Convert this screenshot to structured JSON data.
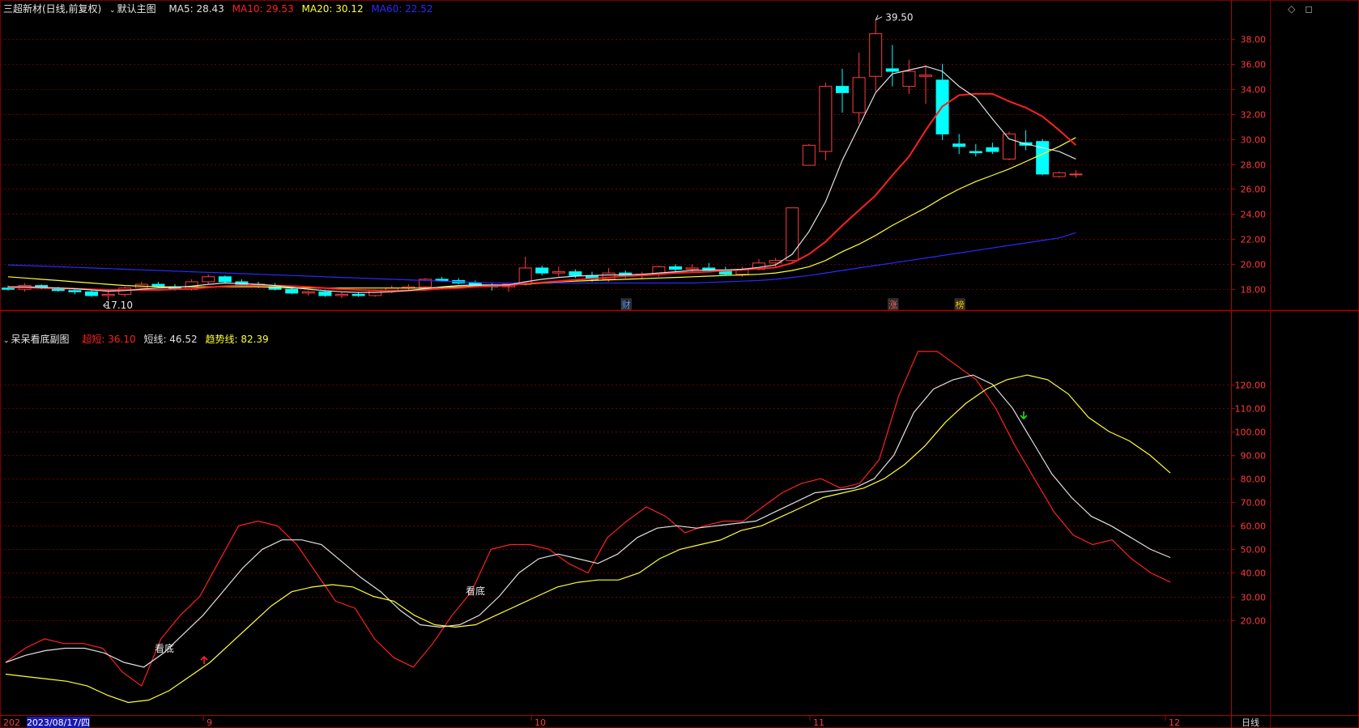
{
  "main_header": {
    "stock": "三超新材(日线,前复权)",
    "view": "默认主图",
    "ma": [
      {
        "label": "MA5: 28.43",
        "color": "#e0e0e0"
      },
      {
        "label": "MA10: 29.53",
        "color": "#ff2020"
      },
      {
        "label": "MA20: 30.12",
        "color": "#ffff33"
      },
      {
        "label": "MA60: 22.52",
        "color": "#2a2aff"
      }
    ]
  },
  "sub_header": {
    "title": "呆呆看底副图",
    "lines": [
      {
        "label": "超短: 36.10",
        "color": "#ff2020"
      },
      {
        "label": "短线: 46.52",
        "color": "#e0e0e0"
      },
      {
        "label": "趋势线: 82.39",
        "color": "#ffff33"
      }
    ]
  },
  "window_icons": {
    "diamond": "◇",
    "restore": "◻"
  },
  "price_axis": [
    "38.00",
    "36.00",
    "34.00",
    "32.00",
    "30.00",
    "28.00",
    "26.00",
    "24.00",
    "22.00",
    "20.00",
    "18.00"
  ],
  "sub_axis": [
    "120.00",
    "110.00",
    "100.00",
    "90.00",
    "80.00",
    "70.00",
    "60.00",
    "50.00",
    "40.00",
    "30.00",
    "20.00"
  ],
  "annotations": {
    "high": "39.50",
    "low": "17.10"
  },
  "events": [
    "财",
    "涨",
    "榜"
  ],
  "signals": [
    "看底",
    "看底"
  ],
  "time_axis": {
    "first": "202",
    "cursor_date": "2023/08/17/四",
    "months": [
      "9",
      "10",
      "11",
      "12"
    ]
  },
  "period": "日线",
  "colors": {
    "up": "#ff3b3b",
    "down": "#00ffff",
    "grid": "#6a0000",
    "axis": "#8a0000",
    "ma5": "#e0e0e0",
    "ma10": "#ff2020",
    "ma20": "#ffff33",
    "ma60": "#2a2aff"
  },
  "chart_data": [
    {
      "type": "candlestick",
      "title": "三超新材(日线,前复权)",
      "ylim": [
        16.4,
        39.8
      ],
      "candles": [
        [
          18.1,
          18.3,
          17.9,
          18.0
        ],
        [
          18.0,
          18.5,
          17.8,
          18.3
        ],
        [
          18.3,
          18.4,
          18.0,
          18.1
        ],
        [
          18.1,
          18.2,
          17.8,
          17.9
        ],
        [
          17.9,
          18.1,
          17.6,
          17.8
        ],
        [
          17.8,
          17.9,
          17.4,
          17.5
        ],
        [
          17.5,
          17.8,
          17.1,
          17.6
        ],
        [
          17.6,
          18.2,
          17.4,
          18.1
        ],
        [
          18.1,
          18.6,
          18.0,
          18.4
        ],
        [
          18.4,
          18.6,
          18.1,
          18.2
        ],
        [
          18.2,
          18.4,
          17.9,
          18.0
        ],
        [
          18.0,
          18.8,
          17.9,
          18.6
        ],
        [
          18.6,
          19.2,
          18.4,
          19.0
        ],
        [
          19.0,
          19.1,
          18.5,
          18.6
        ],
        [
          18.6,
          18.8,
          18.2,
          18.4
        ],
        [
          18.4,
          18.6,
          18.1,
          18.3
        ],
        [
          18.3,
          18.5,
          17.9,
          18.0
        ],
        [
          18.0,
          18.1,
          17.6,
          17.7
        ],
        [
          17.7,
          17.9,
          17.5,
          17.8
        ],
        [
          17.8,
          17.9,
          17.4,
          17.5
        ],
        [
          17.5,
          17.8,
          17.3,
          17.6
        ],
        [
          17.6,
          17.8,
          17.4,
          17.5
        ],
        [
          17.5,
          18.0,
          17.4,
          17.9
        ],
        [
          17.9,
          18.3,
          17.7,
          18.1
        ],
        [
          18.1,
          18.4,
          17.9,
          18.2
        ],
        [
          18.2,
          18.9,
          18.0,
          18.8
        ],
        [
          18.8,
          19.0,
          18.6,
          18.7
        ],
        [
          18.7,
          18.9,
          18.4,
          18.5
        ],
        [
          18.5,
          18.7,
          18.2,
          18.3
        ],
        [
          18.3,
          18.5,
          17.9,
          18.2
        ],
        [
          18.2,
          18.3,
          17.8,
          18.4
        ],
        [
          18.4,
          20.6,
          18.3,
          19.7
        ],
        [
          19.7,
          19.9,
          19.1,
          19.3
        ],
        [
          19.3,
          19.8,
          19.0,
          19.4
        ],
        [
          19.4,
          19.6,
          18.9,
          19.1
        ],
        [
          19.1,
          19.4,
          18.6,
          18.8
        ],
        [
          18.8,
          19.7,
          18.6,
          19.3
        ],
        [
          19.3,
          19.5,
          18.9,
          19.1
        ],
        [
          19.1,
          19.4,
          18.8,
          19.2
        ],
        [
          19.2,
          19.9,
          19.0,
          19.8
        ],
        [
          19.8,
          20.0,
          19.3,
          19.6
        ],
        [
          19.6,
          20.0,
          19.4,
          19.7
        ],
        [
          19.7,
          20.1,
          19.4,
          19.5
        ],
        [
          19.5,
          19.8,
          19.1,
          19.2
        ],
        [
          19.2,
          19.8,
          19.0,
          19.6
        ],
        [
          19.6,
          20.4,
          19.5,
          20.1
        ],
        [
          20.1,
          20.5,
          19.8,
          20.3
        ],
        [
          20.3,
          24.5,
          20.2,
          24.5
        ],
        [
          27.9,
          29.6,
          27.9,
          29.5
        ],
        [
          29.0,
          34.5,
          28.3,
          34.2
        ],
        [
          34.2,
          35.6,
          32.1,
          33.7
        ],
        [
          32.1,
          36.9,
          31.2,
          34.9
        ],
        [
          35.0,
          39.5,
          33.8,
          38.4
        ],
        [
          35.6,
          37.5,
          34.2,
          35.4
        ],
        [
          34.2,
          36.3,
          33.6,
          35.4
        ],
        [
          35.0,
          35.9,
          32.8,
          35.1
        ],
        [
          34.7,
          36.0,
          29.9,
          30.4
        ],
        [
          29.6,
          30.4,
          28.8,
          29.4
        ],
        [
          29.0,
          29.6,
          28.6,
          28.9
        ],
        [
          29.3,
          29.7,
          28.8,
          29.0
        ],
        [
          28.4,
          30.6,
          28.3,
          30.4
        ],
        [
          29.7,
          30.7,
          29.1,
          29.5
        ],
        [
          29.8,
          30.0,
          27.1,
          27.2
        ],
        [
          27.0,
          27.4,
          26.9,
          27.3
        ],
        [
          27.2,
          27.5,
          26.9,
          27.2
        ]
      ],
      "ma5": [
        18.2,
        18.2,
        18.15,
        18.1,
        18.05,
        17.95,
        17.85,
        17.9,
        18.0,
        18.1,
        18.15,
        18.25,
        18.4,
        18.5,
        18.45,
        18.4,
        18.3,
        18.15,
        18.0,
        17.9,
        17.8,
        17.75,
        17.75,
        17.8,
        17.9,
        18.05,
        18.2,
        18.3,
        18.35,
        18.35,
        18.35,
        18.6,
        18.8,
        18.95,
        19.05,
        19.1,
        19.15,
        19.15,
        19.2,
        19.3,
        19.4,
        19.5,
        19.55,
        19.55,
        19.6,
        19.75,
        19.95,
        20.8,
        22.6,
        25.0,
        28.3,
        31.0,
        33.7,
        35.2,
        35.5,
        35.8,
        35.4,
        34.2,
        33.3,
        31.6,
        30.0,
        29.6,
        29.3,
        29.0,
        28.4
      ],
      "ma10": [
        18.15,
        18.15,
        18.1,
        18.1,
        18.05,
        18.0,
        17.95,
        17.95,
        17.95,
        17.95,
        18.0,
        18.05,
        18.15,
        18.25,
        18.3,
        18.3,
        18.3,
        18.25,
        18.2,
        18.1,
        18.0,
        17.95,
        17.9,
        17.9,
        17.9,
        17.95,
        18.05,
        18.1,
        18.2,
        18.25,
        18.3,
        18.45,
        18.55,
        18.65,
        18.75,
        18.85,
        18.95,
        19.05,
        19.1,
        19.2,
        19.3,
        19.35,
        19.4,
        19.5,
        19.55,
        19.65,
        19.75,
        20.1,
        20.8,
        21.8,
        23.1,
        24.3,
        25.5,
        27.1,
        28.6,
        30.7,
        32.6,
        33.5,
        33.6,
        33.6,
        33.0,
        32.5,
        31.8,
        30.7,
        29.5
      ],
      "ma20": [
        19.0,
        18.9,
        18.8,
        18.7,
        18.6,
        18.5,
        18.4,
        18.3,
        18.25,
        18.2,
        18.2,
        18.2,
        18.2,
        18.2,
        18.2,
        18.2,
        18.15,
        18.1,
        18.1,
        18.1,
        18.1,
        18.1,
        18.1,
        18.1,
        18.1,
        18.1,
        18.15,
        18.2,
        18.25,
        18.3,
        18.35,
        18.4,
        18.5,
        18.6,
        18.65,
        18.7,
        18.75,
        18.8,
        18.85,
        18.9,
        18.95,
        19.0,
        19.05,
        19.1,
        19.15,
        19.2,
        19.3,
        19.5,
        19.8,
        20.3,
        21.0,
        21.6,
        22.3,
        23.1,
        23.8,
        24.5,
        25.3,
        26.0,
        26.6,
        27.1,
        27.6,
        28.2,
        28.8,
        29.4,
        30.12
      ],
      "ma60": [
        19.95,
        19.9,
        19.85,
        19.8,
        19.75,
        19.7,
        19.65,
        19.6,
        19.55,
        19.5,
        19.45,
        19.4,
        19.35,
        19.3,
        19.25,
        19.2,
        19.15,
        19.1,
        19.05,
        19.0,
        18.95,
        18.9,
        18.85,
        18.8,
        18.75,
        18.7,
        18.65,
        18.6,
        18.55,
        18.5,
        18.5,
        18.5,
        18.5,
        18.5,
        18.5,
        18.5,
        18.5,
        18.5,
        18.5,
        18.5,
        18.5,
        18.5,
        18.55,
        18.6,
        18.65,
        18.7,
        18.8,
        18.95,
        19.1,
        19.3,
        19.5,
        19.7,
        19.9,
        20.1,
        20.3,
        20.5,
        20.7,
        20.9,
        21.1,
        21.3,
        21.5,
        21.7,
        21.9,
        22.1,
        22.52
      ]
    },
    {
      "type": "line",
      "title": "呆呆看底副图",
      "ylim": [
        -20,
        145
      ],
      "x_span": [
        7,
        1445
      ],
      "series": [
        {
          "name": "超短",
          "values": [
            2,
            8,
            12,
            10,
            10,
            8,
            -2,
            -8,
            12,
            22,
            30,
            45,
            60,
            62,
            60,
            52,
            40,
            28,
            25,
            12,
            4,
            0,
            10,
            22,
            32,
            50,
            52,
            52,
            50,
            44,
            40,
            55,
            62,
            68,
            64,
            57,
            60,
            62,
            62,
            68,
            74,
            78,
            80,
            76,
            78,
            88,
            115,
            134,
            134,
            128,
            122,
            110,
            94,
            80,
            66,
            56,
            52,
            54,
            46,
            40,
            36.1
          ]
        },
        {
          "name": "短线",
          "values": [
            2,
            5,
            7,
            8,
            8,
            6,
            2,
            0,
            6,
            14,
            22,
            32,
            42,
            50,
            54,
            54,
            52,
            45,
            38,
            32,
            24,
            18,
            17,
            18,
            22,
            30,
            40,
            46,
            48,
            46,
            44,
            48,
            55,
            59,
            60,
            59,
            60,
            61,
            62,
            66,
            70,
            74,
            75,
            76,
            80,
            90,
            108,
            118,
            122,
            124,
            120,
            110,
            96,
            82,
            72,
            64,
            60,
            55,
            50,
            46.52
          ]
        },
        {
          "name": "趋势线",
          "values": [
            -3,
            -4,
            -5,
            -6,
            -8,
            -12,
            -15,
            -14,
            -10,
            -4,
            2,
            10,
            18,
            26,
            32,
            34,
            35,
            34,
            30,
            28,
            22,
            18,
            17,
            18,
            22,
            26,
            30,
            34,
            36,
            37,
            37,
            40,
            46,
            50,
            52,
            54,
            58,
            60,
            64,
            68,
            72,
            74,
            76,
            80,
            86,
            94,
            104,
            112,
            118,
            122,
            124,
            122,
            116,
            106,
            100,
            96,
            90,
            82.39
          ]
        }
      ]
    }
  ]
}
